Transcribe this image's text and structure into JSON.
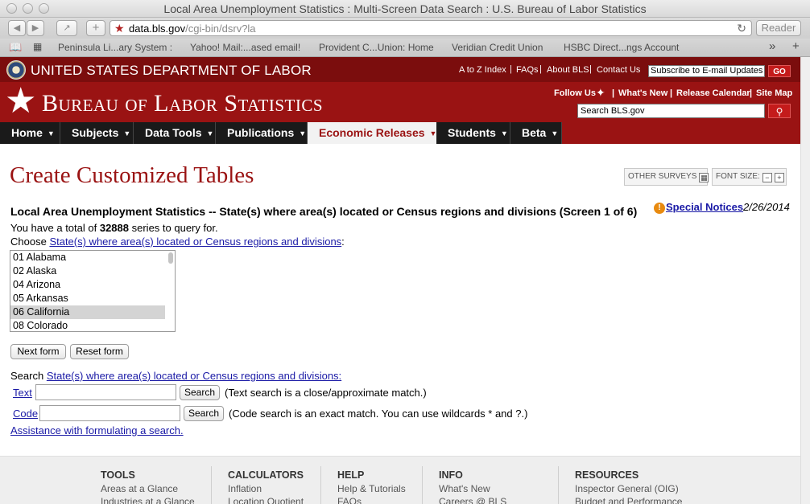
{
  "window": {
    "title": "Local Area Unemployment Statistics : Multi-Screen Data Search : U.S. Bureau of Labor Statistics"
  },
  "browser": {
    "url_host": "data.bls.gov",
    "url_path": "/cgi-bin/dsrv?la",
    "reader_label": "Reader",
    "bookmarks": [
      "Peninsula Li...ary System :",
      "Yahoo! Mail:...ased email!",
      "Provident C...Union: Home",
      "Veridian Credit Union",
      "HSBC Direct...ngs Account"
    ],
    "more_label": "»"
  },
  "dol": {
    "title": "UNITED STATES DEPARTMENT OF LABOR",
    "links": [
      "A to Z Index",
      "FAQs",
      "About BLS",
      "Contact Us"
    ],
    "subscribe_placeholder": "Subscribe to E-mail Updates",
    "go_label": "GO"
  },
  "bls": {
    "title": "Bureau of Labor Statistics",
    "follow_label": "Follow Us",
    "links": [
      "What's New",
      "Release Calendar",
      "Site Map"
    ],
    "search_placeholder": "Search BLS.gov"
  },
  "nav": {
    "items": [
      {
        "label": "Home"
      },
      {
        "label": "Subjects"
      },
      {
        "label": "Data Tools"
      },
      {
        "label": "Publications"
      },
      {
        "label": "Economic Releases"
      },
      {
        "label": "Students"
      },
      {
        "label": "Beta"
      }
    ],
    "active": "Economic Releases"
  },
  "page": {
    "title": "Create Customized Tables",
    "other_surveys": "OTHER SURVEYS",
    "font_size": "FONT SIZE:",
    "heading": "Local Area Unemployment Statistics -- State(s) where area(s) located or Census regions and divisions (Screen 1 of 6)",
    "special_notices": "Special Notices",
    "notice_date": "2/26/2014",
    "total_prefix": "You have a total of",
    "total_count": "32888",
    "total_suffix": "series to query for.",
    "choose_label": "Choose",
    "choose_link": "State(s) where area(s) located or Census regions and divisions",
    "choose_colon": ":",
    "list_options": [
      "01 Alabama",
      "02 Alaska",
      "04 Arizona",
      "05 Arkansas",
      "06 California",
      "08 Colorado"
    ],
    "selected_option": "06 California",
    "next_form": "Next form",
    "reset_form": "Reset form",
    "search_label": "Search",
    "search_link": "State(s) where area(s) located or Census regions and divisions:",
    "text_link": "Text",
    "text_value": "",
    "search_button": "Search",
    "text_note": "(Text search is a close/approximate match.)",
    "code_link": "Code",
    "code_value": "",
    "code_note": "(Code search is an exact match. You can use wildcards * and ?.)",
    "assistance_link": "Assistance with formulating a search."
  },
  "footer": {
    "columns": [
      {
        "head": "TOOLS",
        "items": [
          "Areas at a Glance",
          "Industries at a Glance"
        ]
      },
      {
        "head": "CALCULATORS",
        "items": [
          "Inflation",
          "Location Quotient"
        ]
      },
      {
        "head": "HELP",
        "items": [
          "Help & Tutorials",
          "FAQs"
        ]
      },
      {
        "head": "INFO",
        "items": [
          "What's New",
          "Careers @ BLS"
        ]
      },
      {
        "head": "RESOURCES",
        "items": [
          "Inspector General (OIG)",
          "Budget and Performance"
        ]
      }
    ]
  },
  "colors": {
    "dol_red": "#7b0d0d",
    "bls_red": "#9a1313",
    "nav_dark": "#1a1a1a",
    "link_blue": "#1a1aa6"
  }
}
